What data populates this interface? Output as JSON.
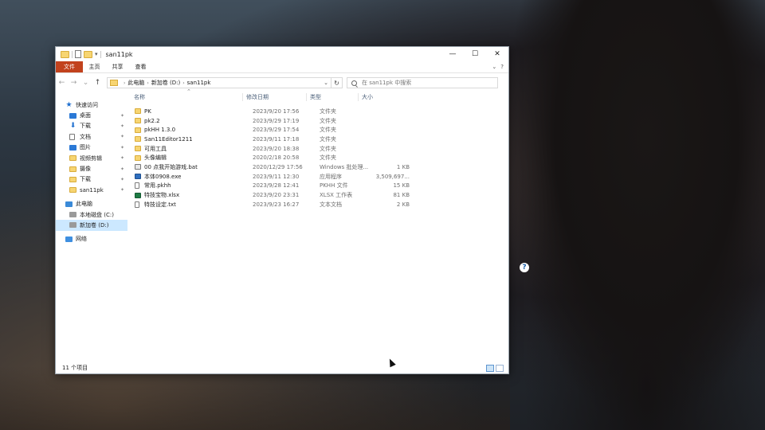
{
  "window": {
    "title": "san11pk",
    "tabs": [
      "文件",
      "主页",
      "共享",
      "查看"
    ],
    "caption": {
      "minimize": "—",
      "maximize": "☐",
      "close": "✕"
    }
  },
  "address": {
    "crumbs": [
      "此电脑",
      "新加卷 (D:)",
      "san11pk"
    ],
    "search_placeholder": "在 san11pk 中搜索"
  },
  "sidebar": {
    "items": [
      {
        "label": "快速访问",
        "icon": "star-icon",
        "pinned": false,
        "level": 0
      },
      {
        "label": "桌面",
        "icon": "desktop-icon",
        "pinned": true,
        "level": 1
      },
      {
        "label": "下载",
        "icon": "download-icon",
        "pinned": true,
        "level": 1
      },
      {
        "label": "文档",
        "icon": "documents-icon",
        "pinned": true,
        "level": 1
      },
      {
        "label": "图片",
        "icon": "pictures-icon",
        "pinned": true,
        "level": 1
      },
      {
        "label": "视频剪辑",
        "icon": "folder-icon",
        "pinned": true,
        "level": 1
      },
      {
        "label": "摄像",
        "icon": "folder-icon",
        "pinned": true,
        "level": 1
      },
      {
        "label": "下载",
        "icon": "folder-icon",
        "pinned": true,
        "level": 1
      },
      {
        "label": "san11pk",
        "icon": "folder-icon",
        "pinned": true,
        "level": 1
      },
      {
        "label": "此电脑",
        "icon": "computer-icon",
        "pinned": false,
        "level": 0
      },
      {
        "label": "本地磁盘 (C:)",
        "icon": "drive-icon",
        "pinned": false,
        "level": 1
      },
      {
        "label": "新加卷 (D:)",
        "icon": "drive-icon",
        "pinned": false,
        "level": 1,
        "selected": true
      },
      {
        "label": "网络",
        "icon": "network-icon",
        "pinned": false,
        "level": 0
      }
    ]
  },
  "columns": {
    "name": "名称",
    "date": "修改日期",
    "type": "类型",
    "size": "大小"
  },
  "files": [
    {
      "name": "PK",
      "date": "2023/9/20 17:56",
      "type": "文件夹",
      "size": "",
      "kind": "folder"
    },
    {
      "name": "pk2.2",
      "date": "2023/9/29 17:19",
      "type": "文件夹",
      "size": "",
      "kind": "folder"
    },
    {
      "name": "pkHH 1.3.0",
      "date": "2023/9/29 17:54",
      "type": "文件夹",
      "size": "",
      "kind": "folder"
    },
    {
      "name": "San11Editor1211",
      "date": "2023/9/11 17:18",
      "type": "文件夹",
      "size": "",
      "kind": "folder"
    },
    {
      "name": "可用工具",
      "date": "2023/9/20 18:38",
      "type": "文件夹",
      "size": "",
      "kind": "folder"
    },
    {
      "name": "头像编辑",
      "date": "2020/2/18 20:58",
      "type": "文件夹",
      "size": "",
      "kind": "folder"
    },
    {
      "name": "00 点我开始游戏.bat",
      "date": "2020/12/29 17:56",
      "type": "Windows 批处理...",
      "size": "1 KB",
      "kind": "bat"
    },
    {
      "name": "本体0908.exe",
      "date": "2023/9/11 12:30",
      "type": "应用程序",
      "size": "3,509,697...",
      "kind": "exe"
    },
    {
      "name": "常用.pkhh",
      "date": "2023/9/28 12:41",
      "type": "PKHH 文件",
      "size": "15 KB",
      "kind": "file"
    },
    {
      "name": "特技宝物.xlsx",
      "date": "2023/9/20 23:31",
      "type": "XLSX 工作表",
      "size": "81 KB",
      "kind": "xlsx"
    },
    {
      "name": "特技设定.txt",
      "date": "2023/9/23 16:27",
      "type": "文本文档",
      "size": "2 KB",
      "kind": "txt"
    }
  ],
  "status": {
    "item_count": "11 个项目"
  },
  "desktop": {
    "help_glyph": "?"
  }
}
